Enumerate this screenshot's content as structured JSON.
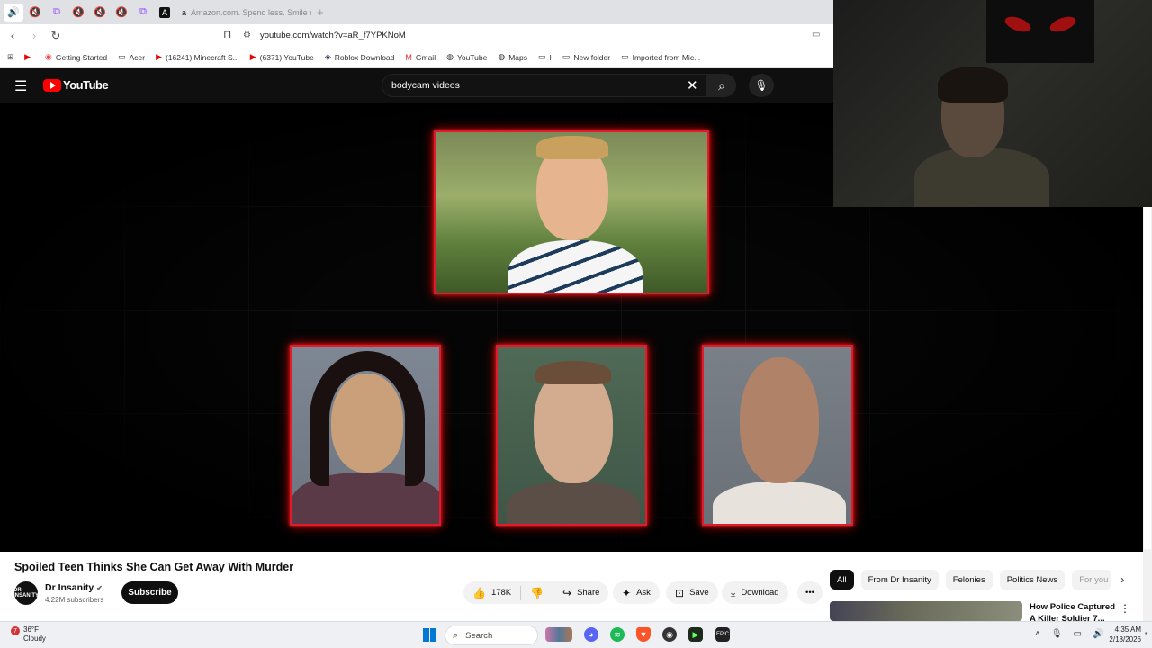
{
  "browser": {
    "tabs": [
      {
        "icon": "speaker-icon",
        "glyph": "🔊",
        "active": true
      },
      {
        "icon": "muted-icon",
        "glyph": "🔇"
      },
      {
        "icon": "twitch-icon",
        "glyph": "⧉"
      },
      {
        "icon": "muted-icon",
        "glyph": "🔇"
      },
      {
        "icon": "muted-icon",
        "glyph": "🔇"
      },
      {
        "icon": "muted-icon",
        "glyph": "🔇"
      },
      {
        "icon": "twitch-icon",
        "glyph": "⧉"
      },
      {
        "icon": "app-icon",
        "glyph": "A"
      }
    ],
    "amazon_tab": "Amazon.com. Spend less. Smile more",
    "new_tab": "+",
    "url": "youtube.com/watch?v=aR_f7YPKNoM",
    "bookmarks": [
      {
        "label": "",
        "icon": "youtube-icon"
      },
      {
        "label": "Getting Started",
        "icon": "globe-icon"
      },
      {
        "label": "Acer",
        "icon": "folder-icon"
      },
      {
        "label": "(16241) Minecraft S...",
        "icon": "youtube-icon"
      },
      {
        "label": "(6371) YouTube",
        "icon": "youtube-icon"
      },
      {
        "label": "Roblox Download",
        "icon": "roblox-icon"
      },
      {
        "label": "Gmail",
        "icon": "gmail-icon"
      },
      {
        "label": "YouTube",
        "icon": "globe-icon"
      },
      {
        "label": "Maps",
        "icon": "globe-icon"
      },
      {
        "label": "I",
        "icon": "folder-icon"
      },
      {
        "label": "New folder",
        "icon": "folder-icon"
      },
      {
        "label": "Imported from Mic...",
        "icon": "folder-icon"
      }
    ]
  },
  "youtube": {
    "logo_text": "YouTube",
    "search_value": "bodycam videos",
    "video_title": "Spoiled Teen Thinks She Can Get Away With Murder",
    "channel": {
      "avatar_text": "DR INSANITY",
      "name": "Dr Insanity",
      "subscribers": "4.22M subscribers"
    },
    "subscribe_label": "Subscribe",
    "actions": {
      "likes": "178K",
      "share": "Share",
      "ask": "Ask",
      "save": "Save",
      "download": "Download"
    },
    "chips": [
      "All",
      "From Dr Insanity",
      "Felonies",
      "Politics News",
      "For you"
    ],
    "recommendation": {
      "title": "How Police Captured A Killer Soldier 7..."
    }
  },
  "taskbar": {
    "temperature": "36°F",
    "condition": "Cloudy",
    "weather_badge": "7",
    "search_placeholder": "Search",
    "time": "4:35 AM",
    "date": "2/18/2026"
  },
  "colors": {
    "youtube_red": "#ff0000",
    "photo_border": "#e01b2d",
    "dark_bg": "#0f0f0f"
  }
}
